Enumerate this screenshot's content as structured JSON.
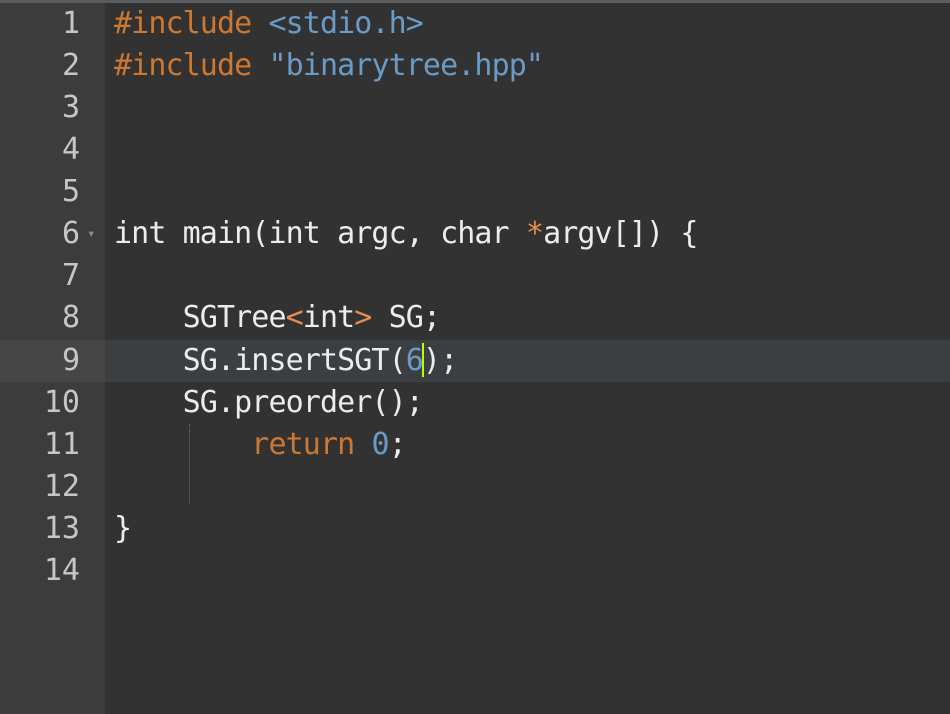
{
  "editor": {
    "lines": [
      {
        "num": "1",
        "tokens": [
          {
            "t": "#include ",
            "c": "kw"
          },
          {
            "t": "<stdio.h>",
            "c": "str"
          }
        ]
      },
      {
        "num": "2",
        "tokens": [
          {
            "t": "#include ",
            "c": "kw"
          },
          {
            "t": "\"binarytree.hpp\"",
            "c": "str"
          }
        ]
      },
      {
        "num": "3",
        "tokens": []
      },
      {
        "num": "4",
        "tokens": []
      },
      {
        "num": "5",
        "tokens": []
      },
      {
        "num": "6",
        "fold": true,
        "tokens": [
          {
            "t": "int main(int argc, char ",
            "c": ""
          },
          {
            "t": "*",
            "c": "op"
          },
          {
            "t": "argv[]) {",
            "c": ""
          }
        ]
      },
      {
        "num": "7",
        "tokens": []
      },
      {
        "num": "8",
        "tokens": [
          {
            "t": "    SGTree",
            "c": ""
          },
          {
            "t": "<",
            "c": "op"
          },
          {
            "t": "int",
            "c": ""
          },
          {
            "t": ">",
            "c": "op"
          },
          {
            "t": " SG;",
            "c": ""
          }
        ]
      },
      {
        "num": "9",
        "current": true,
        "tokens": [
          {
            "t": "    SG.insertSGT(",
            "c": ""
          },
          {
            "t": "6",
            "c": "num"
          },
          {
            "cursor": true
          },
          {
            "t": ");",
            "c": ""
          }
        ]
      },
      {
        "num": "10",
        "tokens": [
          {
            "t": "    SG.preorder();",
            "c": ""
          }
        ]
      },
      {
        "num": "11",
        "tokens": [
          {
            "t": "        ",
            "c": ""
          },
          {
            "t": "return",
            "c": "kw"
          },
          {
            "t": " ",
            "c": ""
          },
          {
            "t": "0",
            "c": "num"
          },
          {
            "t": ";",
            "c": ""
          }
        ]
      },
      {
        "num": "12",
        "tokens": []
      },
      {
        "num": "13",
        "tokens": [
          {
            "t": "}",
            "c": ""
          }
        ]
      },
      {
        "num": "14",
        "tokens": []
      }
    ]
  }
}
